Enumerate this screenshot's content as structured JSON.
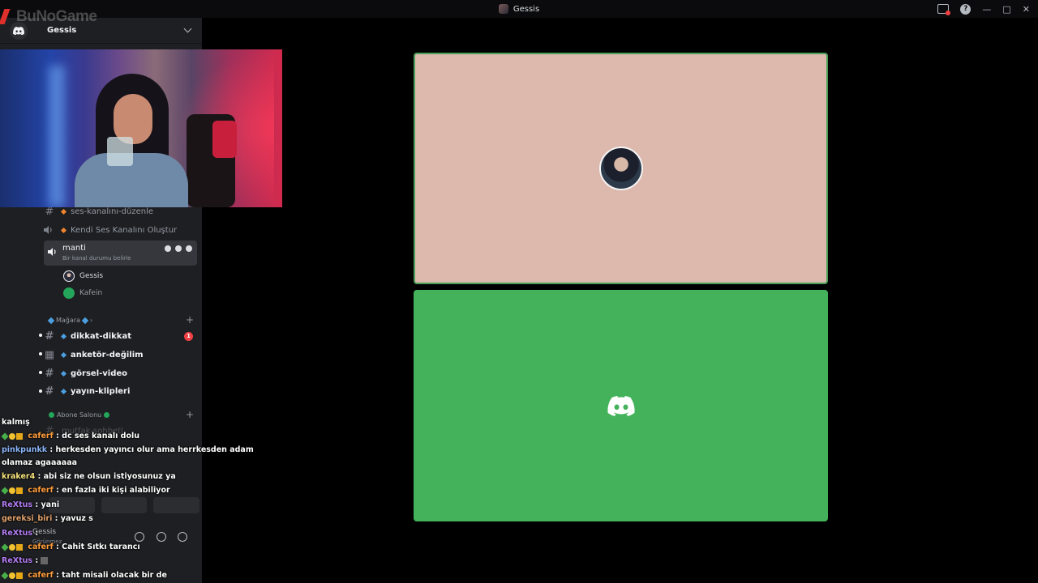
{
  "window": {
    "title": "Gessis"
  },
  "logo": {
    "text": "BuNoGame"
  },
  "server": {
    "name": "Gessis"
  },
  "channels": [
    {
      "name": "ses-kanalını-düzenle",
      "type": "text"
    },
    {
      "name": "Kendi Ses Kanalını Oluştur",
      "type": "voice"
    }
  ],
  "voice_channel": {
    "name": "manti",
    "status": "Bir kanal durumu belirle",
    "members": [
      {
        "name": "Gessis"
      },
      {
        "name": "Kafein"
      }
    ]
  },
  "category_magaza": {
    "label": "Mağara",
    "channels": [
      {
        "name": "dikkat-dikkat",
        "badge": "1"
      },
      {
        "name": "anketör-değilim"
      },
      {
        "name": "görsel-video"
      },
      {
        "name": "yayın-klipleri"
      }
    ]
  },
  "category_abone": {
    "label": "Abone Salonu",
    "channels": [
      {
        "name": "mutfak-sohbeti"
      }
    ]
  },
  "user_panel": {
    "name": "Gessis",
    "status": "Görünmez"
  },
  "chat": [
    {
      "user": "",
      "text": "kalmış"
    },
    {
      "user": "caferf",
      "text": " : dc ses kanalı dolu"
    },
    {
      "user": "pinkpunkk",
      "text": " : herkesden yayıncı olur ama herrkesden adam"
    },
    {
      "user": "",
      "text": "olamaz agaaaaaa"
    },
    {
      "user": "kraker4",
      "text": " : abi siz ne olsun istiyosunuz ya"
    },
    {
      "user": "caferf",
      "text": " : en fazla iki kişi alabiliyor"
    },
    {
      "user": "ReXtus",
      "text": " : yani"
    },
    {
      "user": "gereksi_biri",
      "text": " : yavuz s"
    },
    {
      "user": "ReXtus",
      "text": " : "
    },
    {
      "user": "caferf",
      "text": " : Cahit Sıtkı tarancı"
    },
    {
      "user": "ReXtus",
      "text": " : "
    },
    {
      "user": "caferf",
      "text": " : taht misali olacak bir de"
    }
  ],
  "colors": {
    "tile_top": "#dcb8ad",
    "tile_bottom": "#43b25a",
    "speaking_border": "#4b9f59"
  }
}
